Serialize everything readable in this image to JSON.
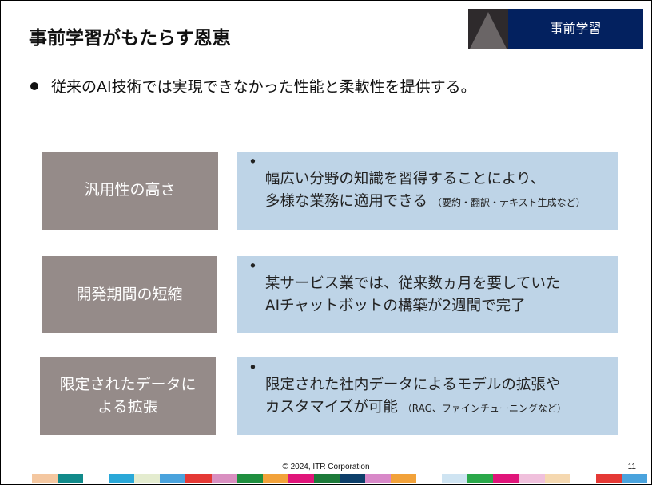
{
  "title": "事前学習がもたらす恩恵",
  "badge": {
    "label": "事前学習"
  },
  "lead": "従来のAI技術では実現できなかった性能と柔軟性を提供する。",
  "rows": [
    {
      "label_lines": [
        "汎用性の高さ"
      ],
      "desc_lines": [
        "幅広い分野の知識を習得することにより、",
        "多様な業務に適用できる"
      ],
      "note": "（要約・翻訳・テキスト生成など）"
    },
    {
      "label_lines": [
        "開発期間の短縮"
      ],
      "desc_lines": [
        "某サービス業では、従来数ヵ月を要していた",
        "AIチャットボットの構築が2週間で完了"
      ],
      "note": ""
    },
    {
      "label_lines": [
        "限定されたデータに",
        "よる拡張"
      ],
      "desc_lines": [
        "限定された社内データによるモデルの拡張や",
        "カスタマイズが可能"
      ],
      "note": "（RAG、ファインチューニングなど）"
    }
  ],
  "bullet": "•",
  "footer": "© 2024, ITR Corporation",
  "page_number": "11",
  "colors": {
    "badge_bg": "#03215f",
    "label_box": "#958b89",
    "desc_box": "#bed4e7"
  }
}
